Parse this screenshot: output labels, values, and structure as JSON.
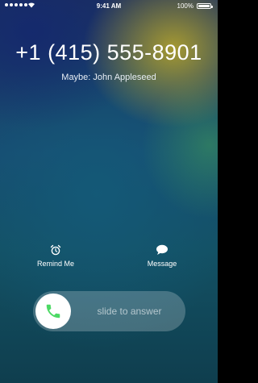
{
  "status_bar": {
    "time": "9:41 AM",
    "battery_percent": "100%",
    "signal_icon": "signal-dots-icon",
    "wifi_icon": "wifi-icon"
  },
  "call": {
    "number": "+1 (415) 555-8901",
    "caller_id": "Maybe: John Appleseed"
  },
  "actions": {
    "remind_label": "Remind Me",
    "message_label": "Message"
  },
  "slider": {
    "label": "slide to answer",
    "accent_color": "#4cd964"
  }
}
